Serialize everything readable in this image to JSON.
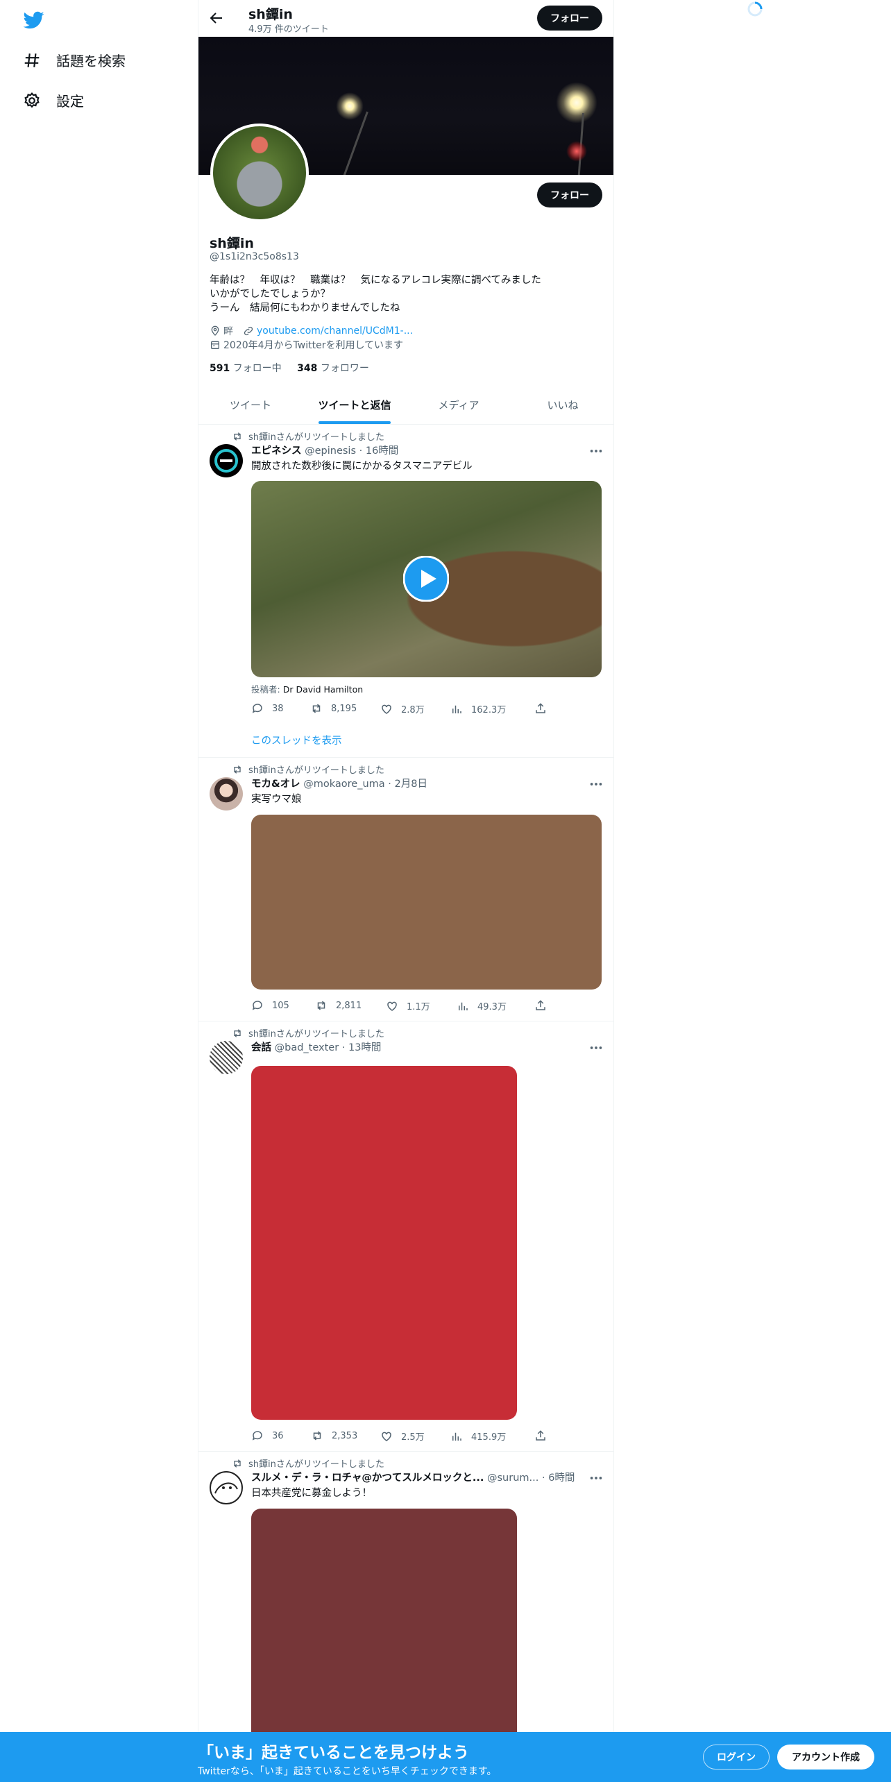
{
  "header": {
    "name": "sh鐔in",
    "tweet_count": "4.9万 件のツイート",
    "follow_label": "フォロー"
  },
  "nav": [
    {
      "label": "話題を検索",
      "icon": "hashtag-icon"
    },
    {
      "label": "設定",
      "icon": "gear-icon"
    }
  ],
  "profile": {
    "name": "sh鐔in",
    "handle": "@1s1i2n3c5o8s13",
    "bio": "年齢は？　年収は？　職業は？　気になるアレコレ実際に調べてみました\nいかがでしたでしょうか？\nうーん　結局何にもわかりませんでしたね",
    "location": "畔",
    "url": "youtube.com/channel/UCdM1-...",
    "joined": "2020年4月からTwitterを利用しています",
    "following_count": "591",
    "following_label": "フォロー中",
    "followers_count": "348",
    "followers_label": "フォロワー",
    "follow_label": "フォロー"
  },
  "tabs": [
    "ツイート",
    "ツイートと返信",
    "メディア",
    "いいね"
  ],
  "active_tab": "ツイートと返信",
  "tweets": [
    {
      "retweet_label": "sh鐔inさんがリツイートしました",
      "name": "エピネシス",
      "handle": "@epinesis",
      "time": "16時間",
      "text": "開放された数秒後に罠にかかるタスマニアデビル",
      "credit_label": "投稿者:",
      "credit_name": "Dr David Hamilton",
      "replies": "38",
      "retweets": "8,195",
      "likes": "2.8万",
      "views": "162.3万",
      "thread_link": "このスレッドを表示"
    },
    {
      "retweet_label": "sh鐔inさんがリツイートしました",
      "name": "モカ&オレ",
      "handle": "@mokaore_uma",
      "time": "2月8日",
      "text": "実写ウマ娘",
      "media_color": "#8b654a",
      "replies": "105",
      "retweets": "2,811",
      "likes": "1.1万",
      "views": "49.3万"
    },
    {
      "retweet_label": "sh鐔inさんがリツイートしました",
      "name": "会話",
      "handle": "@bad_texter",
      "time": "13時間",
      "media_color": "#c72d36",
      "replies": "36",
      "retweets": "2,353",
      "likes": "2.5万",
      "views": "415.9万"
    },
    {
      "retweet_label": "sh鐔inさんがリツイートしました",
      "name": "スルメ・デ・ラ・ロチャ@かつてスルメロックと...",
      "handle": "@surum...",
      "time": "6時間",
      "text": "日本共産党に募金しよう！",
      "media_color": "#763638"
    }
  ],
  "banner_bottom": {
    "title": "「いま」起きていることを見つけよう",
    "subtitle": "Twitterなら、「いま」起きていることをいち早くチェックできます。",
    "login": "ログイン",
    "signup": "アカウント作成"
  }
}
